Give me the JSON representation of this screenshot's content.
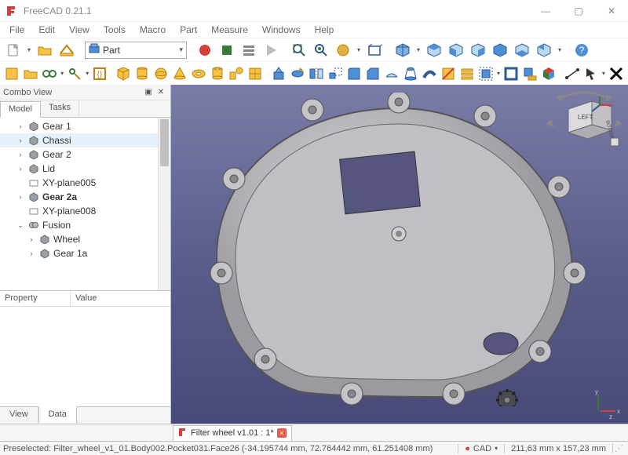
{
  "window": {
    "title": "FreeCAD 0.21.1",
    "min": "—",
    "max": "▢",
    "close": "✕"
  },
  "menus": [
    "File",
    "Edit",
    "View",
    "Tools",
    "Macro",
    "Part",
    "Measure",
    "Windows",
    "Help"
  ],
  "workbench": {
    "label": "Part"
  },
  "combo": {
    "title": "Combo View",
    "tabs": {
      "model": "Model",
      "tasks": "Tasks"
    },
    "tree": [
      {
        "exp": "›",
        "kind": "body",
        "label": "Gear 1",
        "depth": 1
      },
      {
        "exp": "›",
        "kind": "body",
        "label": "Chassi",
        "depth": 1,
        "sel": true
      },
      {
        "exp": "›",
        "kind": "body",
        "label": "Gear 2",
        "depth": 1
      },
      {
        "exp": "›",
        "kind": "body",
        "label": "Lid",
        "depth": 1
      },
      {
        "exp": "",
        "kind": "plane",
        "label": "XY-plane005",
        "depth": 1
      },
      {
        "exp": "›",
        "kind": "body",
        "label": "Gear 2a",
        "depth": 1,
        "bold": true
      },
      {
        "exp": "",
        "kind": "plane",
        "label": "XY-plane008",
        "depth": 1
      },
      {
        "exp": "⌄",
        "kind": "fusion",
        "label": "Fusion",
        "depth": 1
      },
      {
        "exp": "›",
        "kind": "body",
        "label": "Wheel",
        "depth": 2
      },
      {
        "exp": "›",
        "kind": "body",
        "label": "Gear 1a",
        "depth": 2
      }
    ],
    "props": {
      "c1": "Property",
      "c2": "Value",
      "tab_view": "View",
      "tab_data": "Data"
    }
  },
  "doc_tab": {
    "label": "Filter wheel v1.01 : 1*",
    "close": "×"
  },
  "navcube": {
    "left_face": "LEFT",
    "bottom_face": "BOTTOM"
  },
  "status": {
    "message": "Preselected: Filter_wheel_v1_01.Body002.Pocket031.Face26 (-34.195744 mm, 72.764442 mm, 61.251408 mm)",
    "mode_icon": "●",
    "mode": "CAD",
    "dims": "211,63 mm x 157,23 mm"
  },
  "axes": {
    "x": "x",
    "y": "y",
    "z": "z"
  }
}
